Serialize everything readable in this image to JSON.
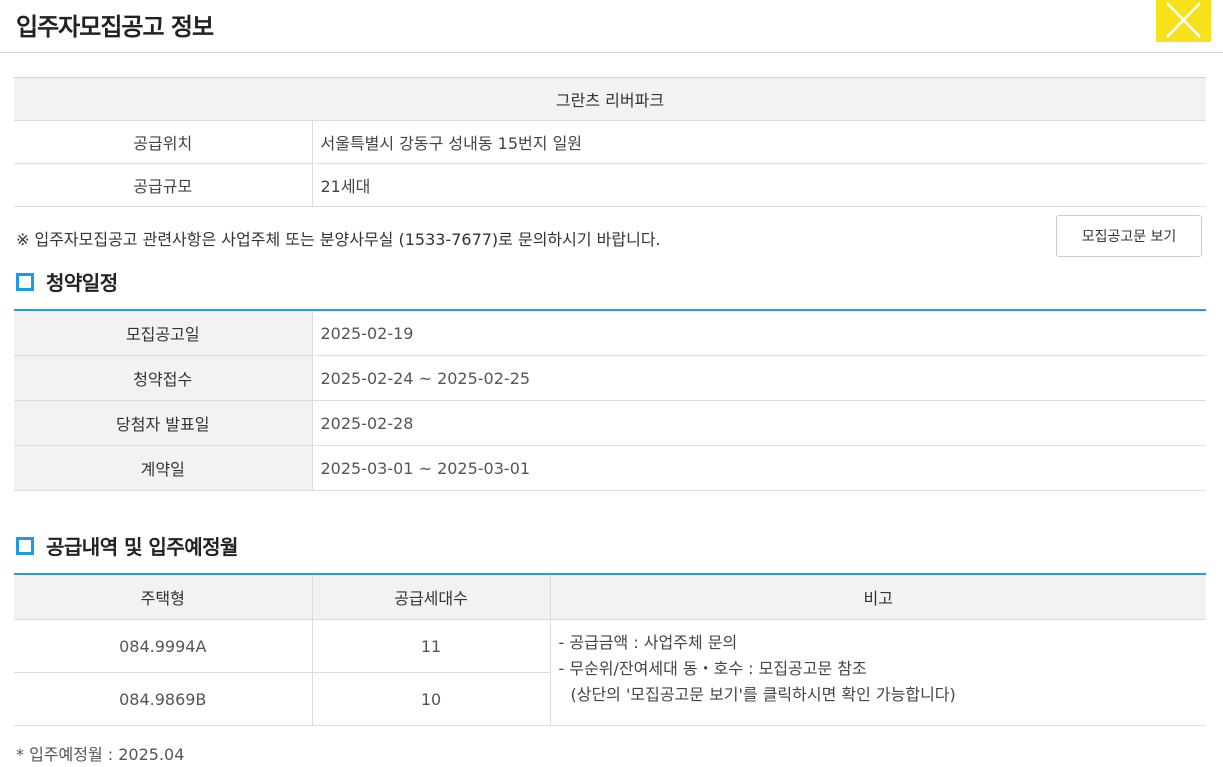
{
  "header": {
    "title": "입주자모집공고 정보"
  },
  "info": {
    "complex_name": "그란츠 리버파크",
    "rows": [
      {
        "label": "공급위치",
        "value": "서울특별시 강동구 성내동 15번지 일원"
      },
      {
        "label": "공급규모",
        "value": "21세대"
      }
    ],
    "notice": "※ 입주자모집공고 관련사항은 사업주체 또는 분양사무실 (1533-7677)로 문의하시기 바랍니다.",
    "view_button": "모집공고문 보기"
  },
  "schedule": {
    "title": "청약일정",
    "rows": [
      {
        "label": "모집공고일",
        "value": "2025-02-19"
      },
      {
        "label": "청약접수",
        "value": "2025-02-24 ~ 2025-02-25"
      },
      {
        "label": "당첨자 발표일",
        "value": "2025-02-28"
      },
      {
        "label": "계약일",
        "value": "2025-03-01 ~ 2025-03-01"
      }
    ]
  },
  "supply": {
    "title": "공급내역 및 입주예정월",
    "columns": [
      "주택형",
      "공급세대수",
      "비고"
    ],
    "rows": [
      {
        "type": "084.9994A",
        "units": "11"
      },
      {
        "type": "084.9869B",
        "units": "10"
      }
    ],
    "notes": [
      "-  공급금액 : 사업주체 문의",
      "-  무순위/잔여세대 동・호수 : 모집공고문 참조",
      "(상단의 '모집공고문 보기'를 클릭하시면 확인 가능합니다)"
    ],
    "footer": "* 입주예정월 : 2025.04"
  },
  "colors": {
    "accent": "#2a9be0",
    "close_button": "#f7e21a"
  },
  "icons": [
    "close-icon",
    "square-bullet-icon"
  ]
}
